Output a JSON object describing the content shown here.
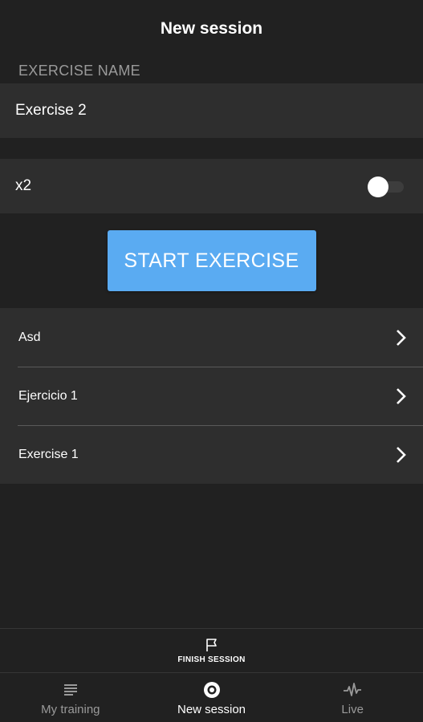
{
  "header": {
    "title": "New session"
  },
  "form": {
    "section_label": "EXERCISE NAME",
    "exercise_name_value": "Exercise 2",
    "toggle_label": "x2",
    "toggle_on": false,
    "start_label": "START EXERCISE"
  },
  "exercises": [
    {
      "label": "Asd"
    },
    {
      "label": "Ejercicio 1"
    },
    {
      "label": "Exercise 1"
    }
  ],
  "finish": {
    "label": "FINISH SESSION"
  },
  "nav": {
    "items": [
      {
        "label": "My training",
        "icon": "list-icon",
        "active": false
      },
      {
        "label": "New session",
        "icon": "record-icon",
        "active": true
      },
      {
        "label": "Live",
        "icon": "pulse-icon",
        "active": false
      }
    ]
  },
  "colors": {
    "background": "#212121",
    "surface": "#2e2e2e",
    "accent": "#5aabf2",
    "muted": "#9a9a9a"
  }
}
